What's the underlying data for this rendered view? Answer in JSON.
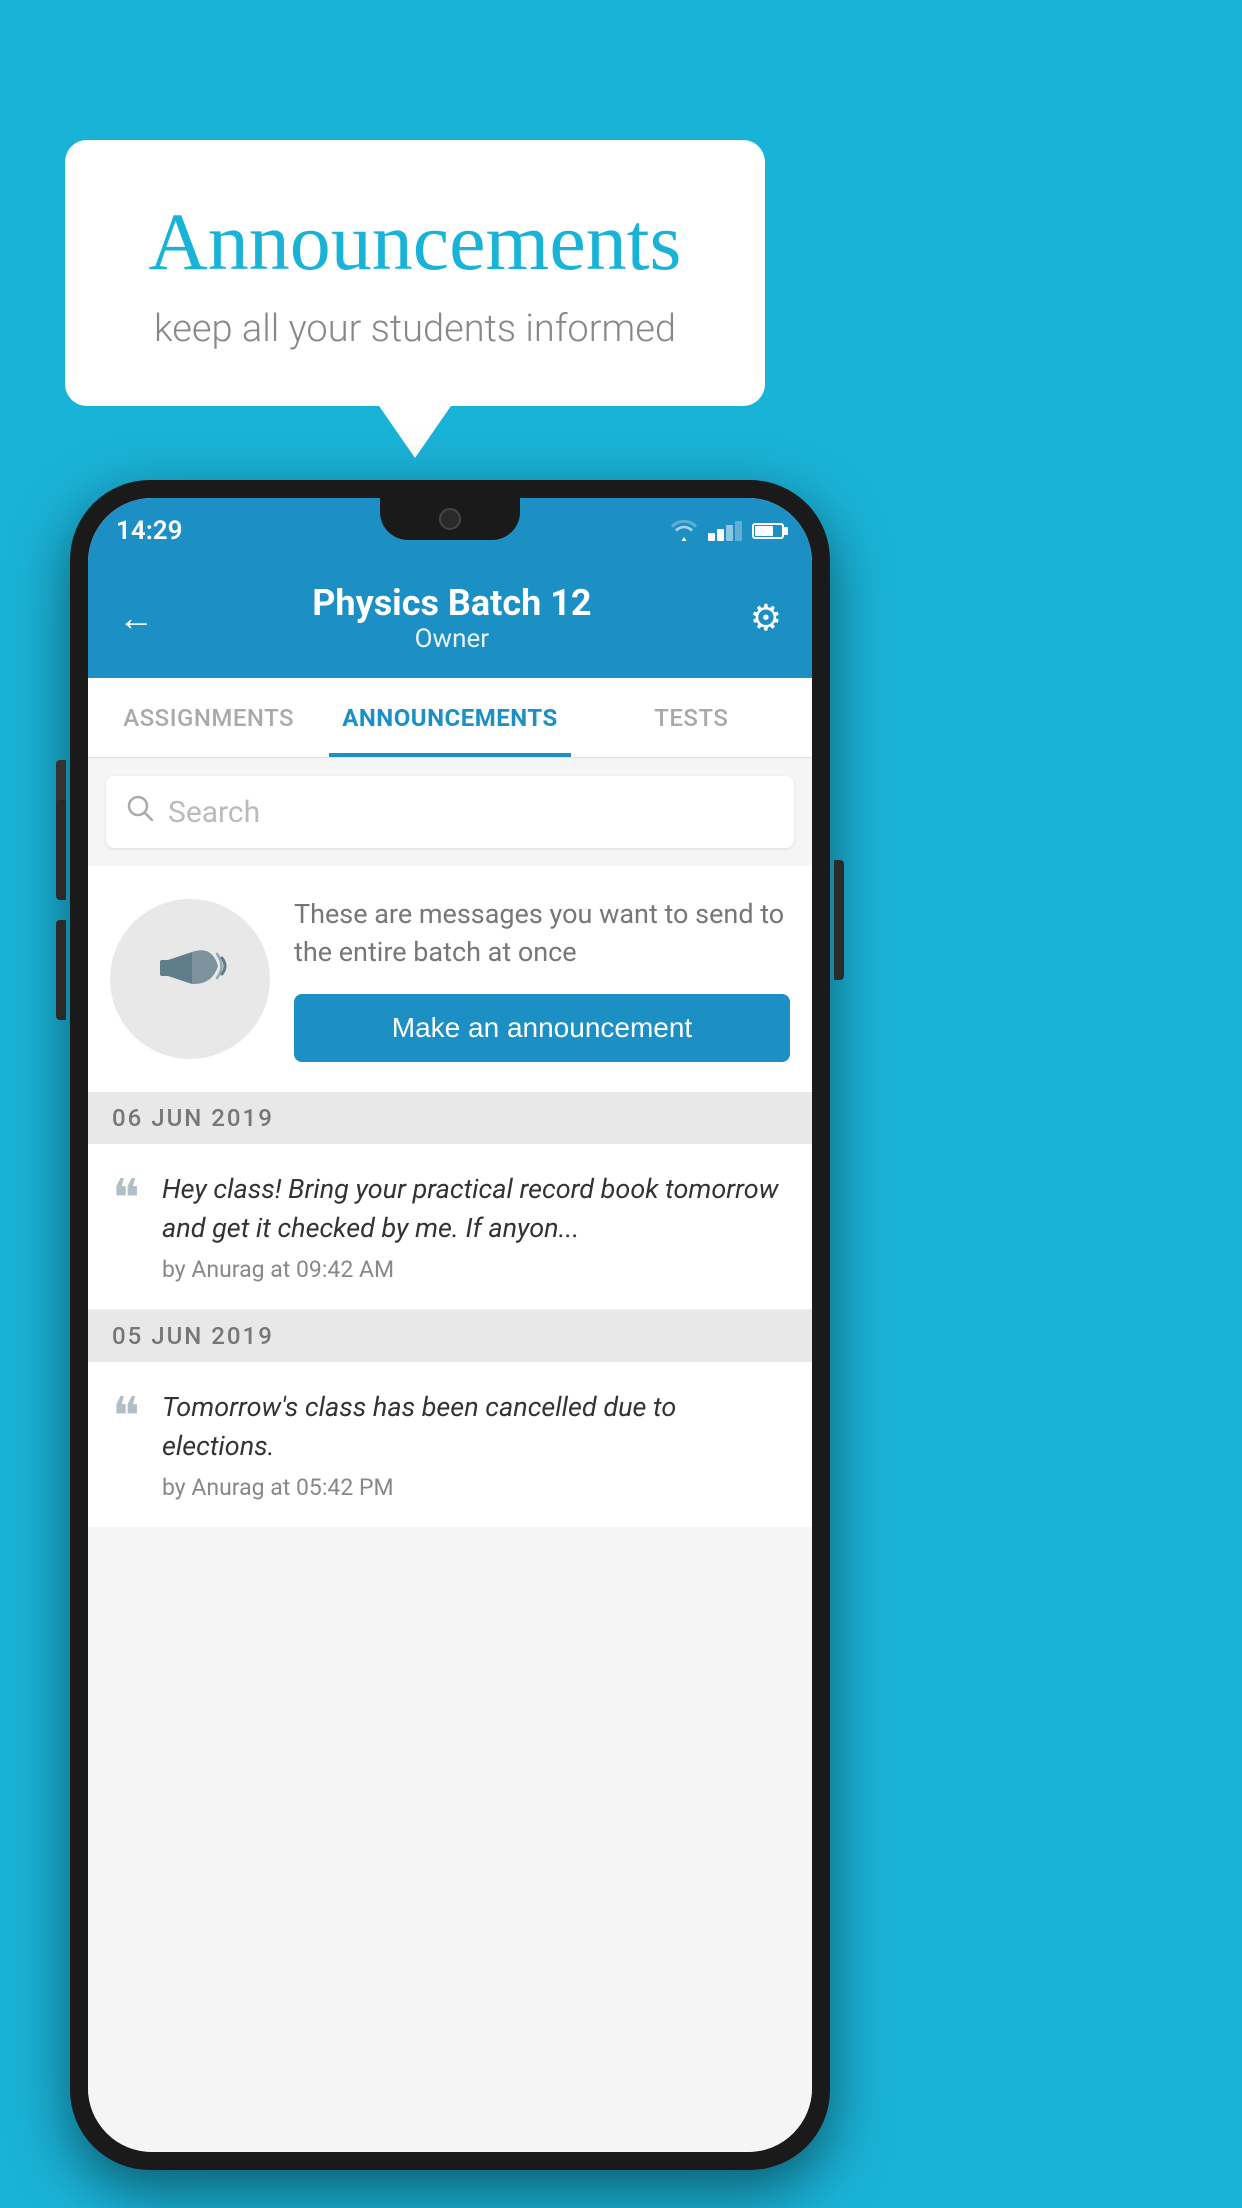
{
  "background": {
    "color": "#1ab3d8"
  },
  "speech_bubble": {
    "title": "Announcements",
    "subtitle": "keep all your students informed"
  },
  "phone": {
    "status_bar": {
      "time": "14:29"
    },
    "header": {
      "title": "Physics Batch 12",
      "subtitle": "Owner",
      "back_label": "←",
      "gear_label": "⚙"
    },
    "tabs": [
      {
        "label": "ASSIGNMENTS",
        "active": false
      },
      {
        "label": "ANNOUNCEMENTS",
        "active": true
      },
      {
        "label": "TESTS",
        "active": false
      }
    ],
    "search": {
      "placeholder": "Search"
    },
    "announcement_prompt": {
      "description": "These are messages you want to send to the entire batch at once",
      "button_label": "Make an announcement"
    },
    "announcements": [
      {
        "date": "06  JUN  2019",
        "text": "Hey class! Bring your practical record book tomorrow and get it checked by me. If anyon...",
        "meta": "by Anurag at 09:42 AM"
      },
      {
        "date": "05  JUN  2019",
        "text": "Tomorrow's class has been cancelled due to elections.",
        "meta": "by Anurag at 05:42 PM"
      }
    ]
  }
}
